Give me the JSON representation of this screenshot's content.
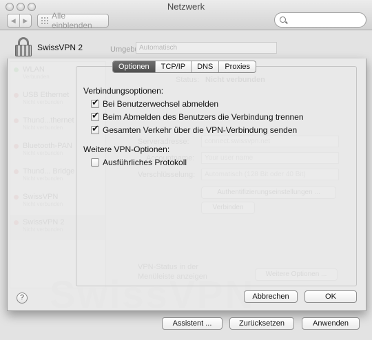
{
  "window": {
    "title": "Netzwerk"
  },
  "toolbar": {
    "back_glyph": "◀",
    "forward_glyph": "▶",
    "show_all_label": "Alle einblenden",
    "search_placeholder": ""
  },
  "connection": {
    "name": "SwissVPN 2"
  },
  "background": {
    "location_label": "Umgebung:",
    "location_value": "Automatisch",
    "status_label": "Status:",
    "status_value": "Nicht verbunden",
    "server_label": "Serveradresse:",
    "server_value": "connect.swissvpn.net",
    "account_label": "Accountname:",
    "account_value": "Your user name",
    "encryption_label": "Verschlüsselung:",
    "encryption_value": "Automatisch (128 Bit oder 40 Bit)",
    "auth_button": "Authentifizierungseinstellungen ...",
    "connect_button": "Verbinden",
    "show_status_label": "VPN-Status in der",
    "show_status_label2": "Menüleiste anzeigen",
    "advanced_button": "Weitere Optionen ...",
    "watermark": "SwissVPN",
    "sidebar_items": [
      {
        "label": "WLAN",
        "sub": "Verbunden"
      },
      {
        "label": "USB Ethernet",
        "sub": "Nicht verbunden"
      },
      {
        "label": "Thund...thernet",
        "sub": "Nicht verbunden"
      },
      {
        "label": "Bluetooth-PAN",
        "sub": "Nicht verbunden"
      },
      {
        "label": "Thund... Bridge",
        "sub": "Nicht verbunden"
      },
      {
        "label": "SwissVPN",
        "sub": "Nicht verbunden"
      },
      {
        "label": "SwissVPN 2",
        "sub": "Nicht verbunden"
      }
    ]
  },
  "tabs": [
    {
      "label": "Optionen",
      "active": true
    },
    {
      "label": "TCP/IP",
      "active": false
    },
    {
      "label": "DNS",
      "active": false
    },
    {
      "label": "Proxies",
      "active": false
    }
  ],
  "options": {
    "section1_label": "Verbindungsoptionen:",
    "checkbox1": {
      "label": "Bei Benutzerwechsel abmelden",
      "checked": true
    },
    "checkbox2": {
      "label": "Beim Abmelden des Benutzers die Verbindung trennen",
      "checked": true
    },
    "checkbox3": {
      "label": "Gesamten Verkehr über die VPN-Verbindung senden",
      "checked": true
    },
    "section2_label": "Weitere VPN-Optionen:",
    "checkbox4": {
      "label": "Ausführliches Protokoll",
      "checked": false
    }
  },
  "sheet_buttons": {
    "help": "?",
    "cancel": "Abbrechen",
    "ok": "OK"
  },
  "bottom_buttons": {
    "assistant": "Assistent ...",
    "revert": "Zurücksetzen",
    "apply": "Anwenden"
  }
}
